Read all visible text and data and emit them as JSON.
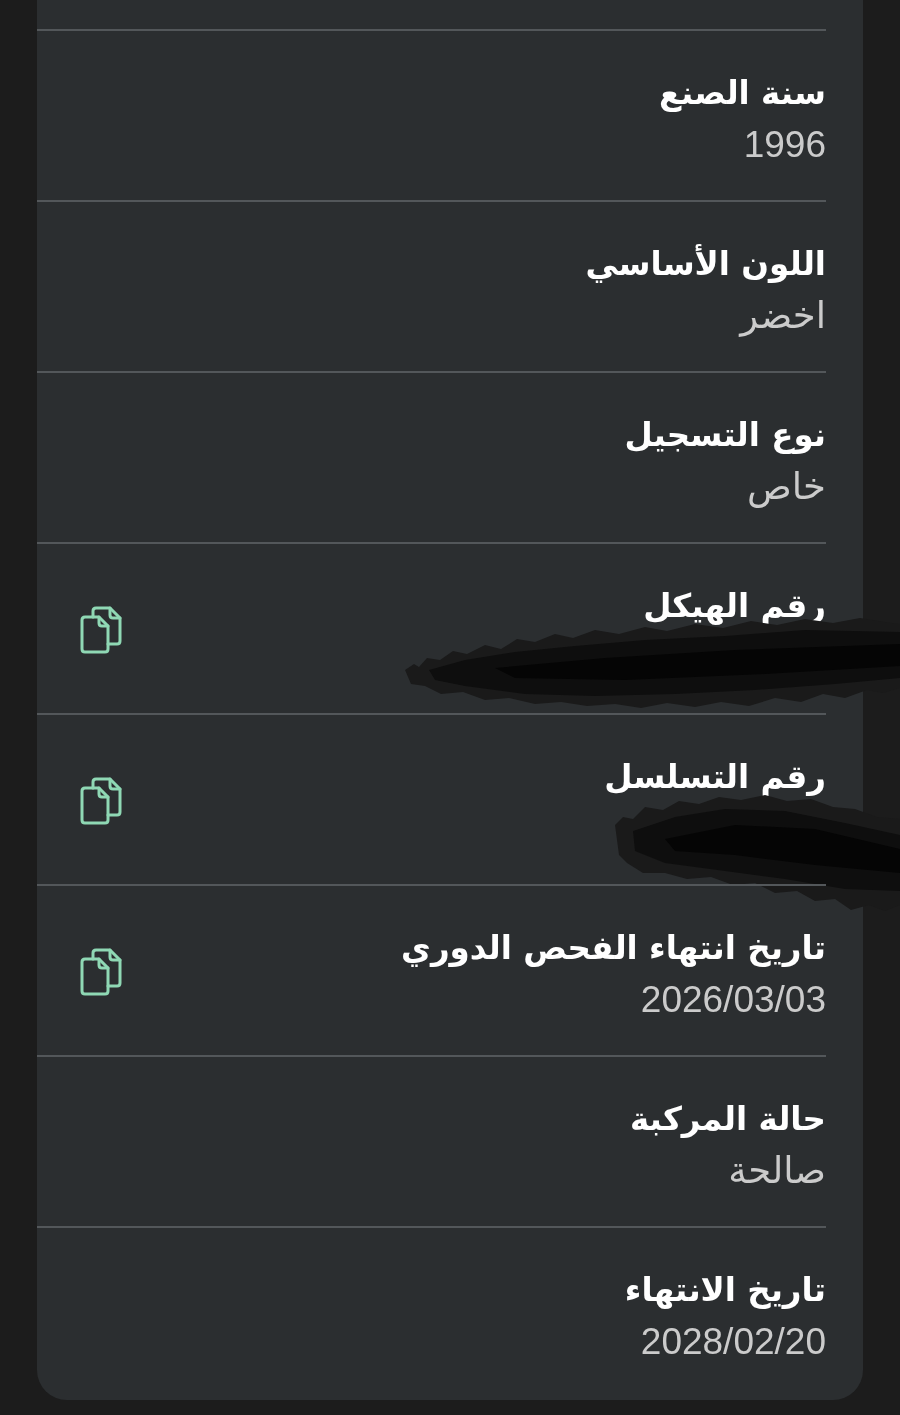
{
  "rows": [
    {
      "label": "سنة الصنع",
      "value": "1996",
      "copyable": false,
      "redacted": false
    },
    {
      "label": "اللون الأساسي",
      "value": "اخضر",
      "copyable": false,
      "redacted": false
    },
    {
      "label": "نوع التسجيل",
      "value": "خاص",
      "copyable": false,
      "redacted": false
    },
    {
      "label": "رقم الهيكل",
      "copyable": true,
      "redacted": true
    },
    {
      "label": "رقم التسلسل",
      "copyable": true,
      "redacted": true
    },
    {
      "label": "تاريخ انتهاء الفحص الدوري",
      "value": "2026/03/03",
      "copyable": true,
      "redacted": false
    },
    {
      "label": "حالة المركبة",
      "value": "صالحة",
      "copyable": false,
      "redacted": false
    },
    {
      "label": "تاريخ الانتهاء",
      "value": "2028/02/20",
      "copyable": false,
      "redacted": false
    }
  ]
}
